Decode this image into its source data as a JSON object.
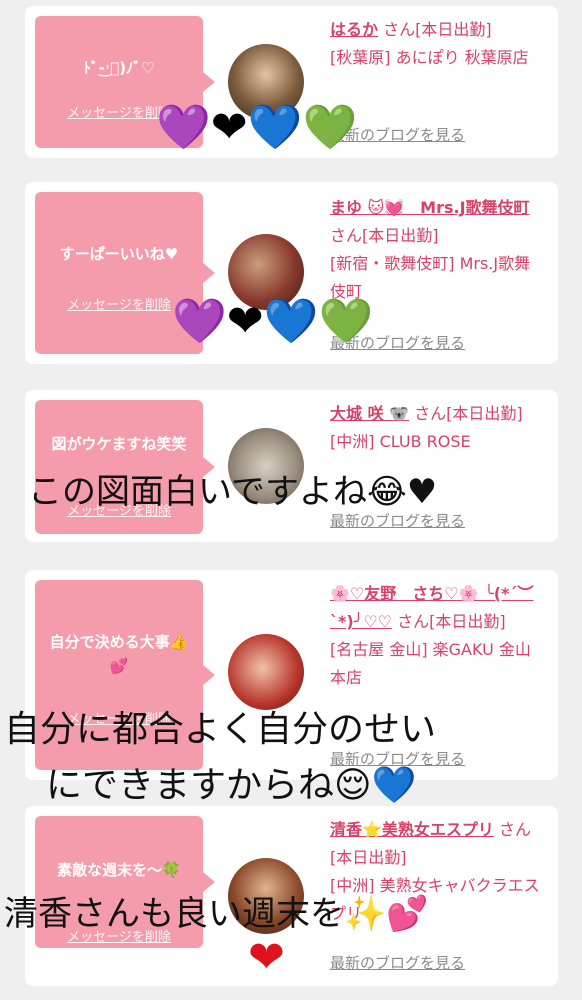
{
  "cards": [
    {
      "message": "ﾄﾞ-͜˒ﾞ)ﾉﾞ♡",
      "delete_label": "メッセージを削除",
      "name": "はるか",
      "san": "さん[本日出勤]",
      "shop": "[秋葉原] あにぽり 秋葉原店",
      "blog_label": "最新のブログを見る"
    },
    {
      "message": "すーぱーいいね♥",
      "delete_label": "メッセージを削除",
      "name": "まゆ 🐱💓　Mrs.J歌舞伎町",
      "san": "さん[本日出勤]",
      "shop": "[新宿・歌舞伎町] Mrs.J歌舞伎町",
      "blog_label": "最新のブログを見る"
    },
    {
      "message": "図がウケますね笑笑",
      "delete_label": "メッセージを削除",
      "name": "大城 咲 🐨",
      "san": "さん[本日出勤]",
      "shop": "[中洲] CLUB ROSE",
      "blog_label": "最新のブログを見る"
    },
    {
      "message": "自分で決める大事👍💕",
      "delete_label": "メッセージを削除",
      "name": "🌸♡友野　さち♡🌸 ╰(*´︶`*)╯♡♡",
      "san": "さん[本日出勤]",
      "shop": "[名古屋 金山] 楽GAKU 金山本店",
      "blog_label": "最新のブログを見る"
    },
    {
      "message": "素敵な週末を〜🍀",
      "delete_label": "メッセージを削除",
      "name": "清香⭐美熟女エスプリ",
      "san": "さん[本日出勤]",
      "shop": "[中洲] 美熟女キャバクラエスプリ",
      "blog_label": "最新のブログを見る"
    }
  ],
  "overlays": {
    "caption1": "この図面白いですよね😂♥",
    "caption2_line1": "自分に都合よく自分のせい",
    "caption2_line2": "にできますからね😌💙",
    "caption3": "清香さんも良い週末を✨💕",
    "hearts_row": "💜❤💙💚",
    "bottom_heart": "❤"
  },
  "colors": {
    "bubble": "#f49cab",
    "accent_text": "#d9416a",
    "muted_text": "#8a8a8a"
  }
}
